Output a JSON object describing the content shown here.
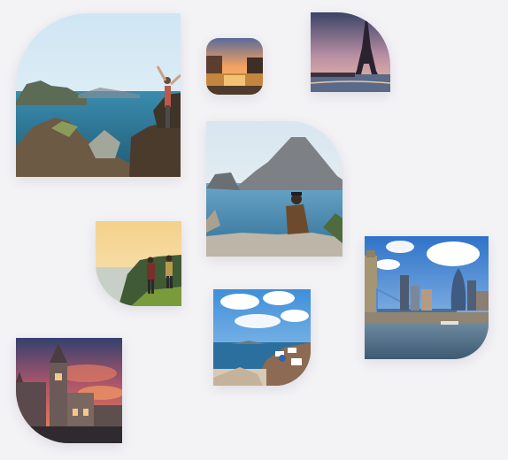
{
  "gallery": {
    "tiles": [
      {
        "id": "t1",
        "subject": "mountain-fjord-hikers"
      },
      {
        "id": "t2",
        "subject": "river-sunset-town"
      },
      {
        "id": "t3",
        "subject": "eiffel-tower-dusk"
      },
      {
        "id": "t4",
        "subject": "sea-rock-sitting-man"
      },
      {
        "id": "t5",
        "subject": "hikers-coastal-sunset"
      },
      {
        "id": "t6",
        "subject": "greek-island-cliff"
      },
      {
        "id": "t7",
        "subject": "london-tower-bridge-skyline"
      },
      {
        "id": "t8",
        "subject": "gothic-town-hall-sunset"
      }
    ]
  }
}
